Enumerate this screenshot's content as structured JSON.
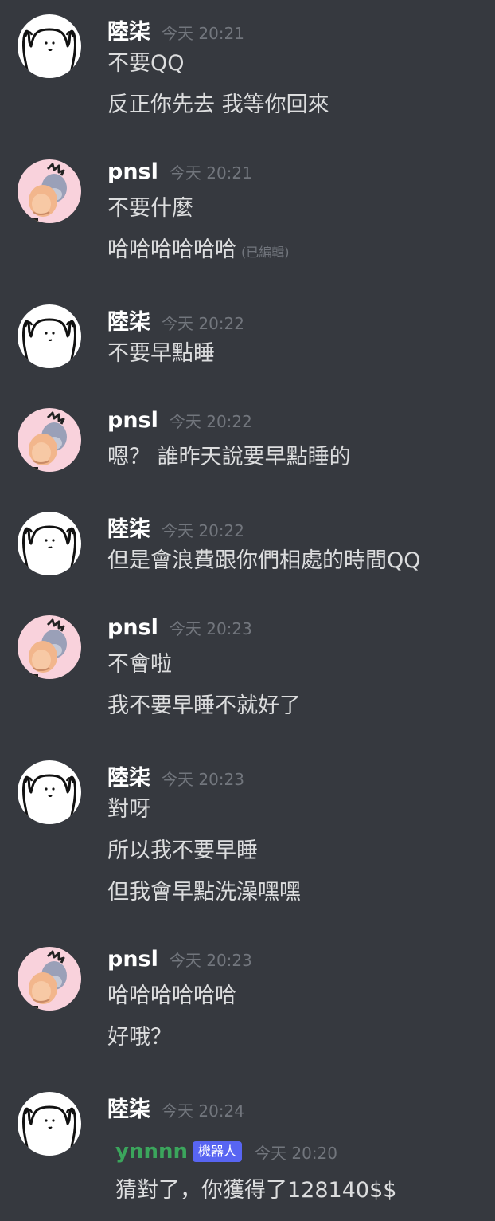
{
  "users": {
    "a": {
      "name": "陸柒",
      "avatar_icon": "doodle-person-arms-up-icon"
    },
    "b": {
      "name": "pnsl",
      "avatar_icon": "eeyore-donkey-icon"
    }
  },
  "messages": [
    {
      "user": "陸柒",
      "time": "今天 20:21",
      "lines": [
        "不要QQ",
        "反正你先去 我等你回來"
      ]
    },
    {
      "user": "pnsl",
      "time": "今天 20:21",
      "lines": [
        "不要什麼",
        "哈哈哈哈哈哈"
      ],
      "edited": "(已編輯)"
    },
    {
      "user": "陸柒",
      "time": "今天 20:22",
      "lines": [
        "不要早點睡"
      ]
    },
    {
      "user": "pnsl",
      "time": "今天 20:22",
      "lines": [
        "嗯？ 誰昨天說要早點睡的"
      ]
    },
    {
      "user": "陸柒",
      "time": "今天 20:22",
      "lines": [
        "但是會浪費跟你們相處的時間QQ"
      ]
    },
    {
      "user": "pnsl",
      "time": "今天 20:23",
      "lines": [
        "不會啦",
        "我不要早睡不就好了"
      ]
    },
    {
      "user": "陸柒",
      "time": "今天 20:23",
      "lines": [
        "對呀",
        "所以我不要早睡",
        "但我會早點洗澡嘿嘿"
      ]
    },
    {
      "user": "pnsl",
      "time": "今天 20:23",
      "lines": [
        "哈哈哈哈哈哈",
        "好哦？"
      ]
    },
    {
      "user": "陸柒",
      "time": "今天 20:24",
      "lines": []
    }
  ],
  "bot_reply": {
    "user": "ynnnn",
    "badge": "機器人",
    "time": "今天 20:20",
    "text": "猜對了，你獲得了128140$$"
  },
  "colors": {
    "background": "#36393f",
    "username": "#ffffff",
    "timestamp": "#72767d",
    "text": "#dcddde",
    "bot_name": "#3ba55c",
    "bot_badge": "#5865f2"
  }
}
